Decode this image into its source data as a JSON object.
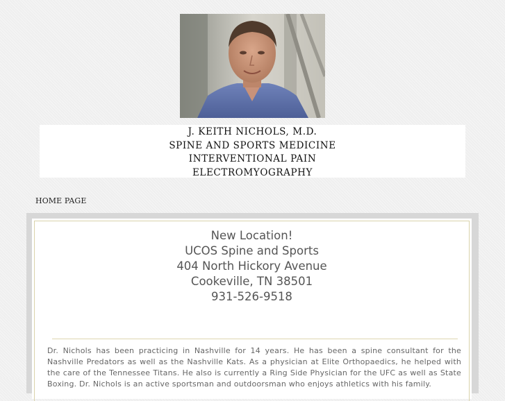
{
  "header": {
    "photo": "portrait-photo",
    "title_lines": [
      "J. KEITH NICHOLS, M.D.",
      "SPINE AND SPORTS MEDICINE",
      "INTERVENTIONAL PAIN",
      "ELECTROMYOGRAPHY"
    ]
  },
  "nav": {
    "home_label": "HOME PAGE"
  },
  "location": {
    "lines": [
      "New Location!",
      "UCOS Spine and Sports",
      "404 North Hickory Avenue",
      "Cookeville, TN 38501",
      "931-526-9518"
    ]
  },
  "bio": {
    "text": "Dr. Nichols has been practicing in Nashville for 14 years. He has been a spine consultant for the Nashville Predators as well as the Nashville Kats. As a physician at Elite Orthopaedics, he helped with the care of the Tennessee Titans.  He also is currently a Ring Side Physician for the UFC as well as State Boxing. Dr. Nichols is an active sportsman and outdoorsman who enjoys athletics with his family."
  },
  "colors": {
    "background": "#efefef",
    "frame": "#d7d7d7",
    "border_accent": "#d9d2aa",
    "text_gray": "#555555"
  }
}
